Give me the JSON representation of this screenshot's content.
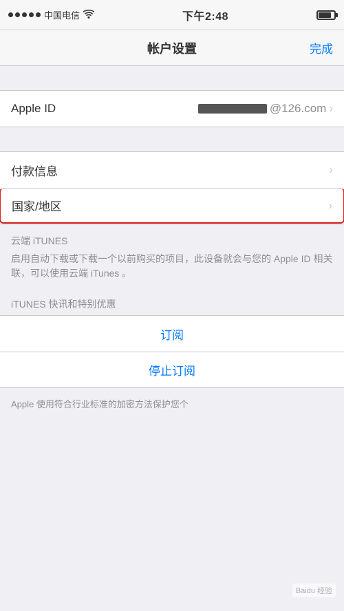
{
  "statusBar": {
    "carrier": "中国电信",
    "time": "下午2:48",
    "signalDots": 5
  },
  "navBar": {
    "title": "帐户设置",
    "doneLabel": "完成"
  },
  "appleIdSection": {
    "label": "Apple ID",
    "emailSuffix": "@126.com"
  },
  "paymentSection": {
    "label": "付款信息"
  },
  "countrySection": {
    "label": "国家/地区"
  },
  "itunesSection": {
    "title": "云端 iTUNES",
    "description": "启用自动下载或下载一个以前购买的项目，此设备就会与您的 Apple ID 相关联，可以使用云端 iTunes 。"
  },
  "newsletterSection": {
    "title": "iTUNES 快讯和特别优惠"
  },
  "subscribeBtn": {
    "label": "订阅"
  },
  "unsubscribeBtn": {
    "label": "停止订阅"
  },
  "footerSection": {
    "text": "Apple 使用符合行业标准的加密方法保护您个"
  },
  "watermark": "Baidu 经验"
}
